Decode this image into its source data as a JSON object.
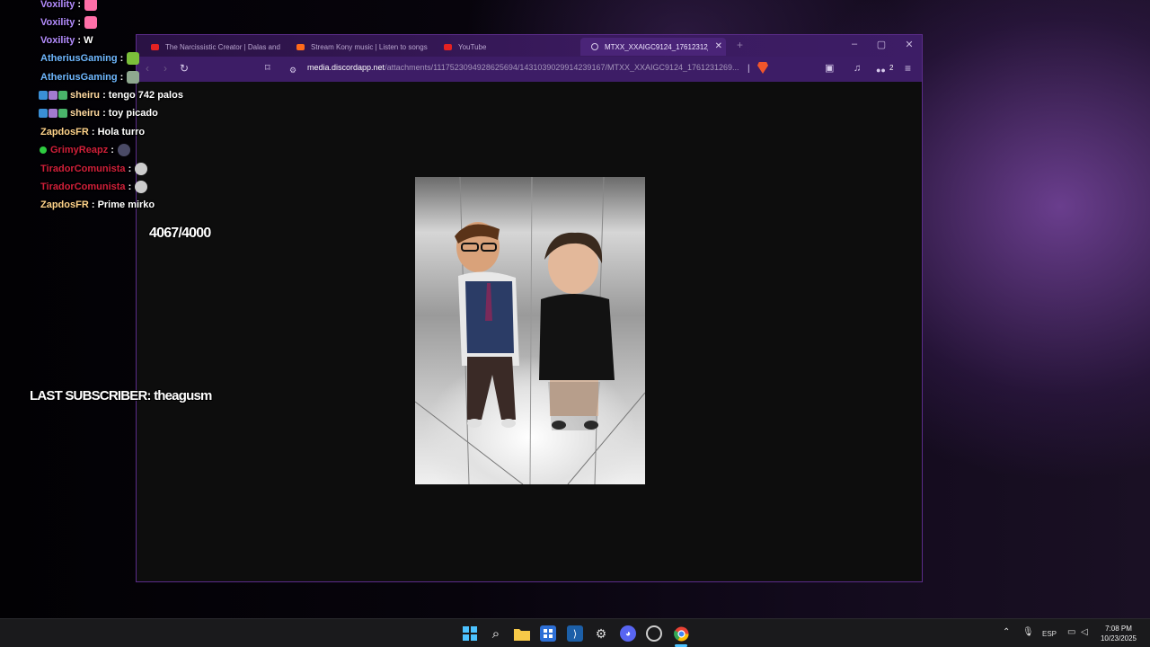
{
  "browser": {
    "tabs": [
      {
        "title": "The Narcissistic Creator | Dalas and t",
        "icon": "youtube-icon",
        "active": false
      },
      {
        "title": "Stream Kony music | Listen to songs",
        "icon": "soundcloud-icon",
        "active": false
      },
      {
        "title": "YouTube",
        "icon": "youtube-icon",
        "active": false
      },
      {
        "title": "MTXX_XXAIGC9124_17612312̦",
        "icon": "globe-icon",
        "active": true
      }
    ],
    "url_host": "media.discordapp.net",
    "url_path": "/attachments/1117523094928625694/1431039029914239167/MTXX_XXAIGC9124_1761231269...",
    "extension_count": "2",
    "image_alt": "Two people standing in a mirrored elevator"
  },
  "chat": {
    "messages": [
      {
        "user": "Voxility",
        "text": ":",
        "color": "#b48cff",
        "badges": [],
        "emote": "#ff6fa8"
      },
      {
        "user": "Voxility",
        "text": ":",
        "color": "#b48cff",
        "badges": [],
        "emote": "#ff6fa8"
      },
      {
        "user": "Voxility",
        "text": ": W",
        "color": "#b48cff",
        "badges": [],
        "emote": ""
      },
      {
        "user": "AtheriusGaming",
        "text": ":",
        "color": "#6fb7ff",
        "badges": [],
        "emote": "#7bbf3a"
      },
      {
        "user": "AtheriusGaming",
        "text": ":",
        "color": "#6fb7ff",
        "badges": [],
        "emote": "#8fa88f"
      },
      {
        "user": "sheiru",
        "text": ": tengo 742 palos",
        "color": "#ffd9a0",
        "badges": [
          "#3a8fd6",
          "#a27bd0",
          "#49b46a"
        ],
        "emote": ""
      },
      {
        "user": "sheiru",
        "text": ": toy picado",
        "color": "#ffd9a0",
        "badges": [
          "#3a8fd6",
          "#a27bd0",
          "#49b46a"
        ],
        "emote": ""
      },
      {
        "user": "ZapdosFR",
        "text": ": Hola turro",
        "color": "#ffd38a",
        "badges": [],
        "emote": ""
      },
      {
        "user": "GrimyReapz",
        "text": ":",
        "color": "#d11f3a",
        "badges": [
          "#2ecc40"
        ],
        "emote": "#4a4a66"
      },
      {
        "user": "TiradorComunista",
        "text": ":",
        "color": "#d11f3a",
        "badges": [],
        "emote": "#cccccc"
      },
      {
        "user": "TiradorComunista",
        "text": ":",
        "color": "#d11f3a",
        "badges": [],
        "emote": "#cccccc"
      },
      {
        "user": "ZapdosFR",
        "text": ": Prime mirko",
        "color": "#ffd38a",
        "badges": [],
        "emote": ""
      }
    ]
  },
  "overlay": {
    "goal": "4067/4000",
    "last_subscriber": "LAST SUBSCRIBER: theagusm"
  },
  "taskbar": {
    "apps": [
      "windows-start-icon",
      "search-icon",
      "file-explorer-icon",
      "store-icon",
      "vscode-icon",
      "steam-icon",
      "discord-icon",
      "obs-icon",
      "chrome-icon"
    ],
    "language": "ESP",
    "time": "7:08 PM",
    "date": "10/23/2025"
  }
}
